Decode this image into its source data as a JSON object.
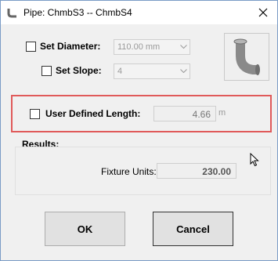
{
  "window": {
    "title": "Pipe: ChmbS3 -- ChmbS4"
  },
  "diameter": {
    "label": "Set Diameter:",
    "value": "110.00 mm",
    "checked": false
  },
  "slope": {
    "label": "Set Slope:",
    "value": "4",
    "checked": false
  },
  "length": {
    "label": "User Defined Length:",
    "value": "4.66",
    "unit": "m",
    "checked": false
  },
  "results": {
    "heading": "Results:",
    "fixture_units_label": "Fixture Units:",
    "fixture_units_value": "230.00"
  },
  "buttons": {
    "ok": "OK",
    "cancel": "Cancel"
  },
  "colors": {
    "highlight": "#e05a5a",
    "preview_pipe": "#8a8a8a"
  },
  "icons": {
    "app": "pipe-app-icon",
    "close": "close-icon",
    "preview": "pipe-elbow-icon"
  }
}
